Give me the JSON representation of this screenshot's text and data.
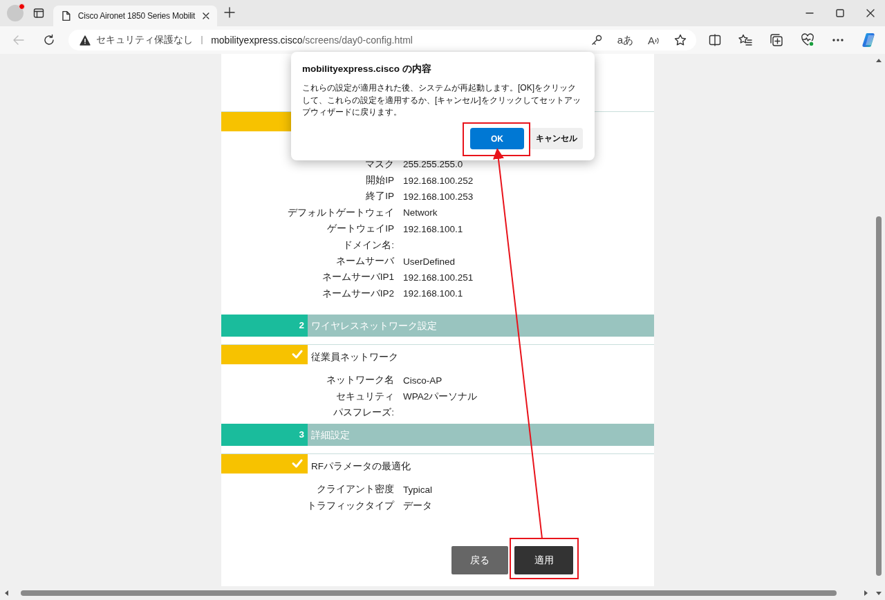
{
  "browser": {
    "tab_title": "Cisco Aironet 1850 Series Mobilit",
    "security_label": "セキュリティ保護なし",
    "url_host": "mobilityexpress.cisco",
    "url_path": "/screens/day0-config.html",
    "translate_glyph": "aあ",
    "read_aloud_glyph": "A"
  },
  "page": {
    "top_rows": [
      {
        "label": "マスク",
        "value": "255.255.255.0"
      },
      {
        "label": "開始IP",
        "value": "192.168.100.252"
      },
      {
        "label": "終了IP",
        "value": "192.168.100.253"
      },
      {
        "label": "デフォルトゲートウェイ",
        "value": "Network"
      },
      {
        "label": "ゲートウェイIP",
        "value": "192.168.100.1"
      },
      {
        "label": "ドメイン名:"
      },
      {
        "label": "ネームサーバ",
        "value": "UserDefined"
      },
      {
        "label": "ネームサーバIP1",
        "value": "192.168.100.251"
      },
      {
        "label": "ネームサーバIP2",
        "value": "192.168.100.1"
      }
    ],
    "sections": [
      {
        "number": "2",
        "title": "ワイヤレスネットワーク設定",
        "subsections": [
          {
            "title": "従業員ネットワーク",
            "checked": true,
            "rows": [
              {
                "label": "ネットワーク名",
                "value": "Cisco-AP"
              },
              {
                "label": "セキュリティ",
                "value": "WPA2パーソナル"
              },
              {
                "label": "パスフレーズ:"
              }
            ]
          }
        ]
      },
      {
        "number": "3",
        "title": "詳細設定",
        "subsections": [
          {
            "title": "RFパラメータの最適化",
            "checked": true,
            "rows": [
              {
                "label": "クライアント密度",
                "value": "Typical"
              },
              {
                "label": "トラフィックタイプ",
                "value": "データ"
              }
            ]
          }
        ]
      }
    ],
    "buttons": [
      {
        "label": "戻る",
        "kind": "secondary"
      },
      {
        "label": "適用",
        "kind": "primary"
      }
    ]
  },
  "dialog": {
    "title": "mobilityexpress.cisco の内容",
    "message": "これらの設定が適用された後、システムが再起動します。[OK]をクリックして、これらの設定を適用するか、[キャンセル]をクリックしてセットアップウィザードに戻ります。",
    "buttons": [
      {
        "label": "OK",
        "kind": "primary"
      },
      {
        "label": "キャンセル",
        "kind": "secondary"
      }
    ]
  }
}
